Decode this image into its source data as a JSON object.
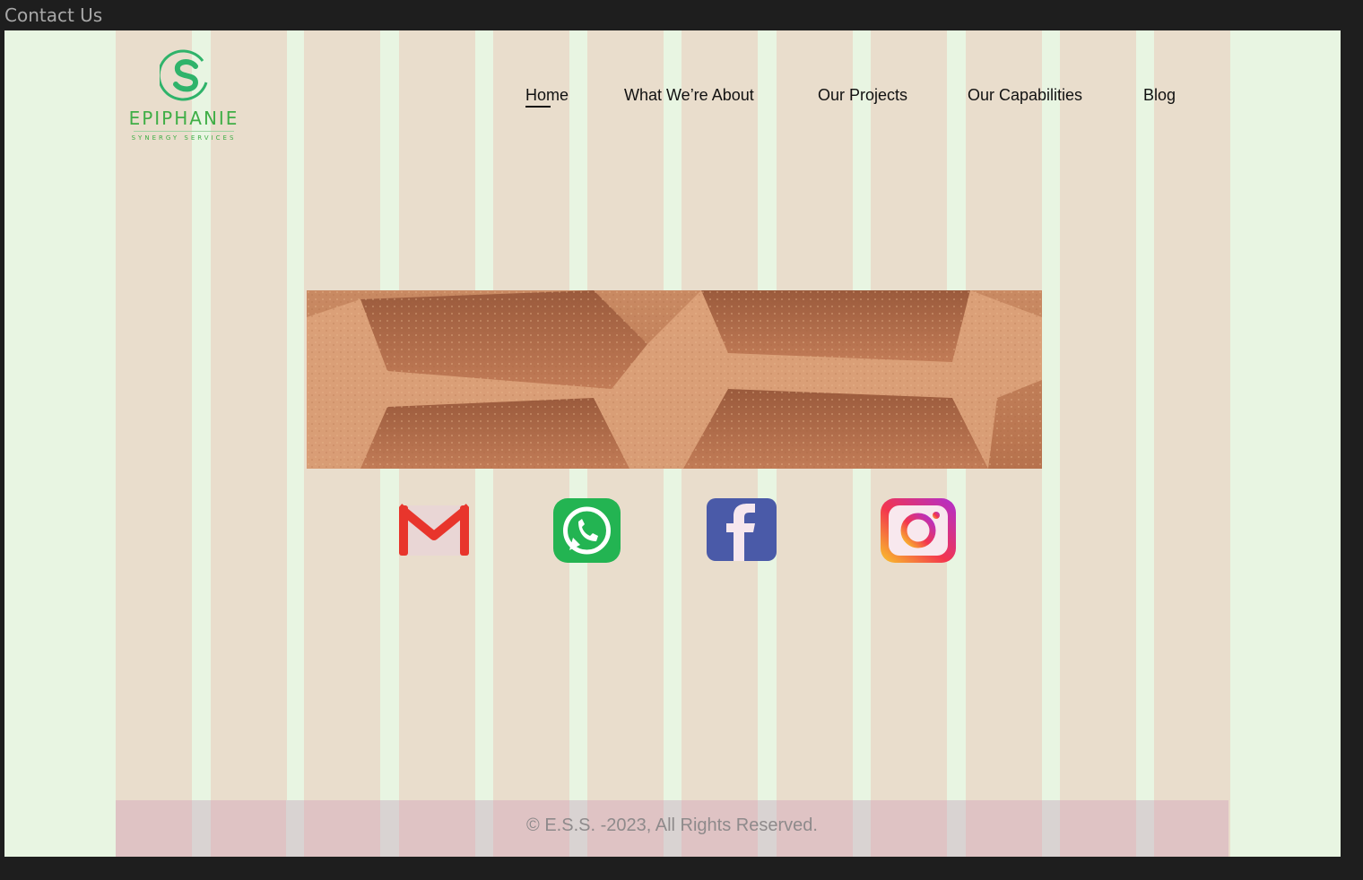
{
  "frame": {
    "label": "Contact Us"
  },
  "logo": {
    "icon": "s-circle-logo-icon",
    "title": "EPIPHANIE",
    "subtitle": "SYNERGY SERVICES",
    "accent": "#2fb36a"
  },
  "nav": {
    "items": [
      {
        "label": "Home",
        "active": true
      },
      {
        "label": "What We’re About",
        "active": false
      },
      {
        "label": "Our Projects",
        "active": false
      },
      {
        "label": "Our Capabilities",
        "active": false
      },
      {
        "label": "Blog",
        "active": false
      }
    ]
  },
  "hero": {
    "icon": "brick-texture-image"
  },
  "socials": [
    {
      "name": "Gmail",
      "icon": "gmail-icon",
      "color": "#e74c3c"
    },
    {
      "name": "WhatsApp",
      "icon": "whatsapp-icon",
      "color": "#25c35a"
    },
    {
      "name": "Facebook",
      "icon": "facebook-icon",
      "color": "#3b5998"
    },
    {
      "name": "Instagram",
      "icon": "instagram-icon",
      "color": "#e1306c"
    }
  ],
  "footer": {
    "copyright": "© E.S.S. -2023, All Rights Reserved."
  },
  "colors": {
    "background": "#e8f5e2",
    "column": "#e9ddcc",
    "footer": "#dfc3c4"
  }
}
